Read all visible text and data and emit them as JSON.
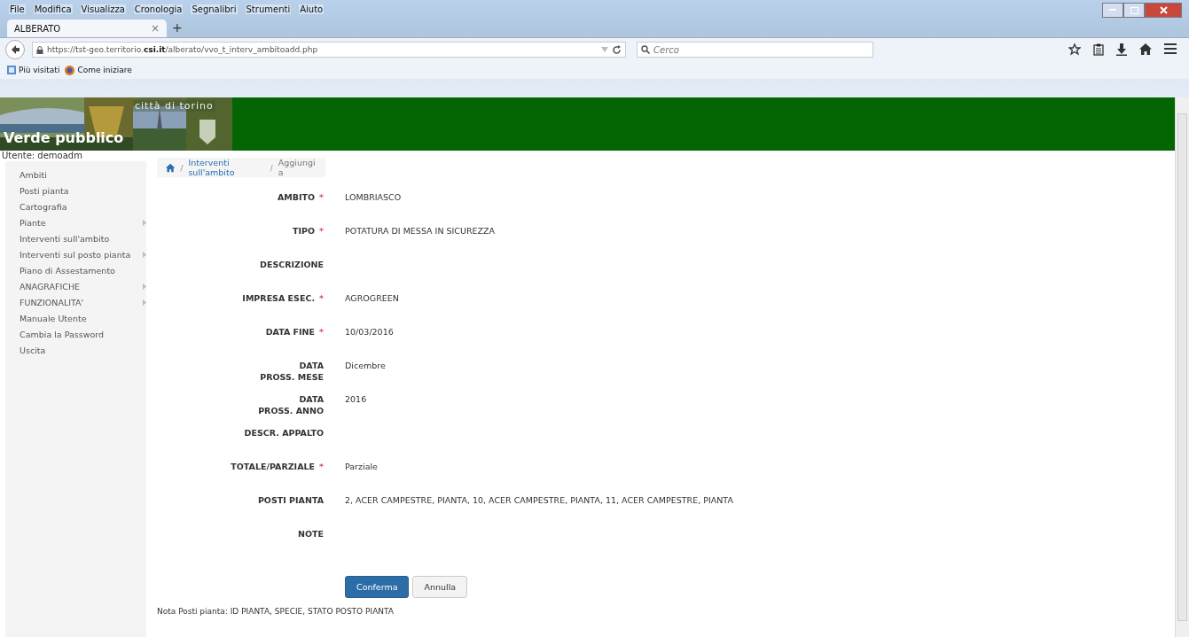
{
  "browser": {
    "menu": [
      "File",
      "Modifica",
      "Visualizza",
      "Cronologia",
      "Segnalibri",
      "Strumenti",
      "Aiuto"
    ],
    "tab": {
      "title": "ALBERATO",
      "close": "×",
      "new": "+"
    },
    "url": "https://tst-geo.territorio.**csi.it**/alberato/vvo_t_interv_ambitoadd.php",
    "search": {
      "placeholder": "Cerco"
    },
    "bookmarks": [
      "Più visitati",
      "Come iniziare"
    ]
  },
  "header": {
    "city": "città di torino",
    "title": "Verde pubblico"
  },
  "user": "Utente: demoadm",
  "sidebar": {
    "items": [
      {
        "label": "Ambiti",
        "has_submenu": false
      },
      {
        "label": "Posti pianta",
        "has_submenu": false
      },
      {
        "label": "Cartografia",
        "has_submenu": false
      },
      {
        "label": "Piante",
        "has_submenu": true
      },
      {
        "label": "Interventi sull'ambito",
        "has_submenu": false
      },
      {
        "label": "Interventi sul posto pianta",
        "has_submenu": true
      },
      {
        "label": "Piano di Assestamento",
        "has_submenu": false
      },
      {
        "label": "ANAGRAFICHE",
        "has_submenu": true
      },
      {
        "label": "FUNZIONALITA'",
        "has_submenu": true
      },
      {
        "label": "Manuale Utente",
        "has_submenu": false
      },
      {
        "label": "Cambia la Password",
        "has_submenu": false
      },
      {
        "label": "Uscita",
        "has_submenu": false
      }
    ]
  },
  "breadcrumb": {
    "separator": "/",
    "link": "Interventi sull'ambito",
    "current": "Aggiungi a"
  },
  "form": {
    "fields": [
      {
        "label": [
          "AMBITO"
        ],
        "required": true,
        "value": "LOMBRIASCO"
      },
      {
        "label": [
          "TIPO"
        ],
        "required": true,
        "value": "POTATURA DI MESSA IN SICUREZZA"
      },
      {
        "label": [
          "DESCRIZIONE"
        ],
        "required": false
      },
      {
        "label": [
          "IMPRESA ESEC."
        ],
        "required": true,
        "value": "AGROGREEN"
      },
      {
        "label": [
          "DATA FINE"
        ],
        "required": true,
        "value": "10/03/2016"
      },
      {
        "label": [
          "DATA",
          "PROSS. MESE"
        ],
        "required": false,
        "value": "Dicembre"
      },
      {
        "label": [
          "DATA",
          "PROSS. ANNO"
        ],
        "required": false,
        "value": "2016"
      },
      {
        "label": [
          "DESCR. APPALTO"
        ],
        "required": false
      },
      {
        "label": [
          "TOTALE/PARZIALE"
        ],
        "required": true,
        "value": "Parziale"
      },
      {
        "label": [
          "POSTI PIANTA"
        ],
        "required": false,
        "value": "2, ACER CAMPESTRE, PIANTA, 10, ACER CAMPESTRE, PIANTA, 11, ACER CAMPESTRE, PIANTA"
      },
      {
        "label": [
          "NOTE"
        ],
        "required": false
      }
    ],
    "buttons": [
      {
        "label": "Conferma",
        "kind": "primary"
      },
      {
        "label": "Annulla",
        "kind": "default"
      }
    ],
    "required_mark": "*"
  },
  "note": "Nota Posti pianta: ID PIANTA, SPECIE, STATO POSTO PIANTA"
}
